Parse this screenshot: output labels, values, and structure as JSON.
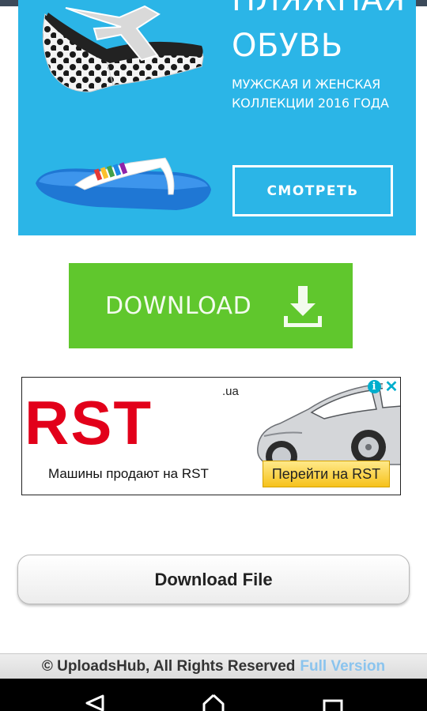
{
  "status_bar": {
    "color": "#3c4a5a"
  },
  "ad_sandals": {
    "headline_line1": "ПЛЯЖНАЯ",
    "headline_line2": "ОБУВЬ",
    "subtitle_line1": "МУЖСКАЯ И ЖЕНСКАЯ",
    "subtitle_line2": "КОЛЛЕКЦИИ 2016 ГОДА",
    "cta_label": "СМОТРЕТЬ",
    "background": "#2bb5e7"
  },
  "download_banner": {
    "label": "DOWNLOAD",
    "icon": "download-arrow-icon",
    "background": "#60c72d"
  },
  "ad_rst": {
    "logo": "RST",
    "domain": ".ua",
    "tagline": "Машины продают на RST",
    "cta_label": "Перейти на RST",
    "adchoices_info": "i",
    "adchoices_close": "✕",
    "brand_color": "#e2001a"
  },
  "download_file_button": {
    "label": "Download File"
  },
  "footer": {
    "copyright": "© UploadsHub, All Rights Reserved",
    "link_label": "Full Version",
    "link_color": "#8bc4ee"
  },
  "nav_bar": {
    "back": "back-icon",
    "home": "home-icon",
    "recents": "recents-icon"
  }
}
